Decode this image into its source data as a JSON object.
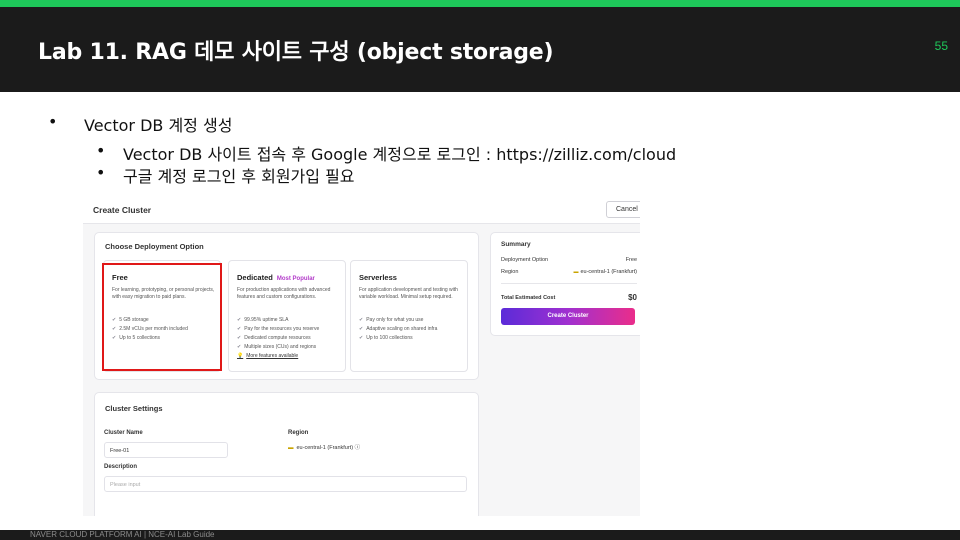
{
  "slide": {
    "title": "Lab 11. RAG 데모 사이트 구성 (object storage)",
    "page_number": "55",
    "footer": "NAVER CLOUD PLATFORM AI  |  NCE-AI Lab Guide"
  },
  "bullets": {
    "l1": {
      "marker": "•",
      "text": "Vector DB 계정 생성"
    },
    "l2": [
      {
        "marker": "•",
        "text": "Vector DB 사이트 접속 후 Google 계정으로 로그인 : https://zilliz.com/cloud"
      },
      {
        "marker": "•",
        "text": "구글 계정 로그인 후 회원가입 필요"
      }
    ]
  },
  "screenshot": {
    "header_title": "Create Cluster",
    "cancel_label": "Cancel",
    "deployment": {
      "title": "Choose Deployment Option",
      "options": [
        {
          "name": "Free",
          "badge": "",
          "desc": "For learning, prototyping, or personal projects, with easy migration to paid plans.",
          "features": [
            "5 GB storage",
            "2.5M vCUs per month included",
            "Up to 5 collections"
          ]
        },
        {
          "name": "Dedicated",
          "badge": "Most Popular",
          "desc": "For production applications with advanced features and custom configurations.",
          "features": [
            "99.95% uptime SLA",
            "Pay for the resources you reserve",
            "Dedicated compute resources",
            "Multiple sizes (CUs) and regions"
          ],
          "link": "More features available"
        },
        {
          "name": "Serverless",
          "badge": "",
          "desc": "For application development and testing with variable workload. Minimal setup required.",
          "features": [
            "Pay only for what you use",
            "Adaptive scaling on shared infra",
            "Up to 100 collections"
          ]
        }
      ]
    },
    "summary": {
      "title": "Summary",
      "deployment_label": "Deployment Option",
      "deployment_value": "Free",
      "region_label": "Region",
      "region_value": "eu-central-1 (Frankfurt)",
      "total_label": "Total Estimated Cost",
      "total_value": "$0",
      "create_button": "Create Cluster"
    },
    "settings": {
      "title": "Cluster Settings",
      "name_label": "Cluster Name",
      "name_value": "Free-01",
      "region_label": "Region",
      "region_value": "eu-central-1 (Frankfurt)",
      "info_icon": "ⓘ",
      "desc_label": "Description",
      "desc_placeholder": "Please input"
    },
    "icons": {
      "check": "✔",
      "bulb": "💡",
      "flag": "▬"
    },
    "highlight_color": "#e01818",
    "accent_gradient": [
      "#5b2bd8",
      "#ea2d8a"
    ]
  }
}
